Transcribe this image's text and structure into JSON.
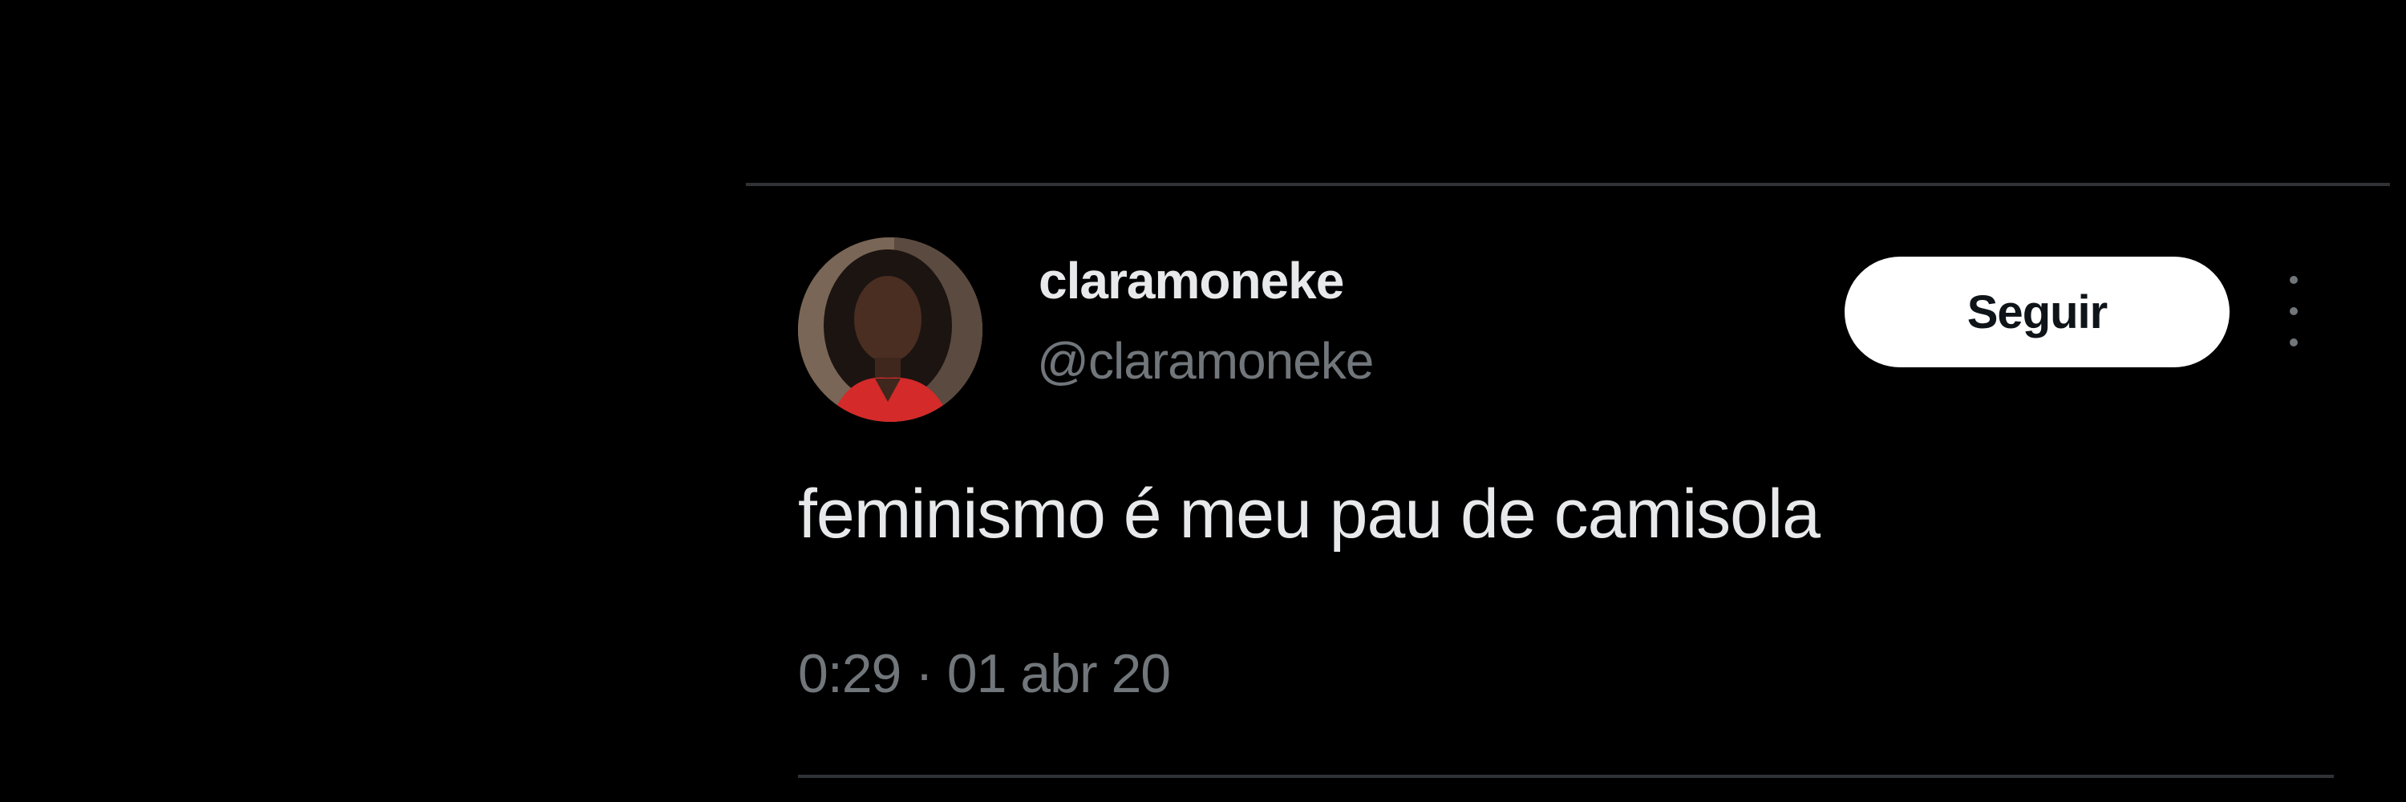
{
  "tweet": {
    "display_name": "claramoneke",
    "handle": "@claramoneke",
    "follow_label": "Seguir",
    "text": "feminismo é meu pau de camisola",
    "timestamp": "0:29 · 01 abr 20",
    "avatar_icon": "avatar-photo",
    "more_icon": "more-vertical-icon"
  },
  "colors": {
    "background": "#000000",
    "divider": "#2f3336",
    "primary_text": "#e7e9ea",
    "secondary_text": "#71767b",
    "follow_button_bg": "#ffffff",
    "follow_button_text": "#0f1419"
  }
}
